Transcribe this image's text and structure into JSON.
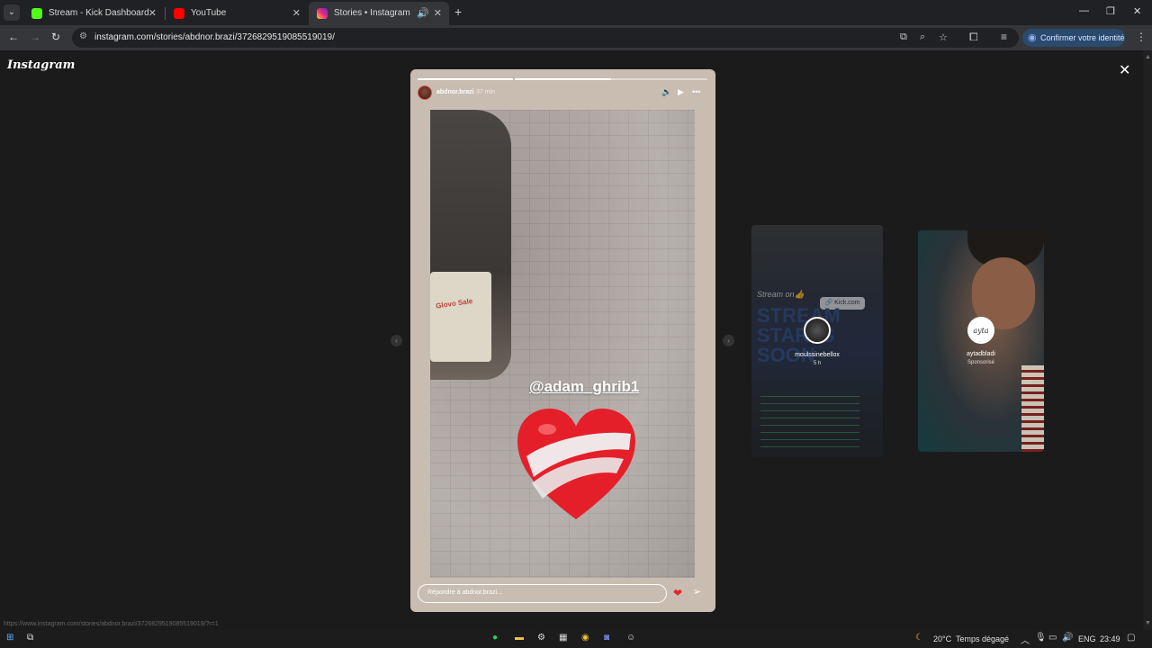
{
  "browser": {
    "tabs": [
      {
        "title": "Stream - Kick Dashboard",
        "icon": "kick-icon",
        "color": "#53fc18"
      },
      {
        "title": "YouTube",
        "icon": "youtube-icon",
        "color": "#ff0000"
      },
      {
        "title": "Stories • Instagram",
        "icon": "instagram-icon",
        "color": "#e1306c"
      }
    ],
    "url": "instagram.com/stories/abdnor.brazi/3726829519085519019/",
    "confirm_identity": "Confirmer votre identité"
  },
  "page": {
    "logo": "Instagram",
    "story": {
      "username": "abdnor.brazi",
      "time": "37 min",
      "mention": "@adam_ghrib1",
      "progress": [
        1.0,
        0.5
      ],
      "reply_placeholder": "Répondre à abdnor.brazi…",
      "scooter_label": "Glovo Sale"
    },
    "previews": [
      {
        "username": "moulssinebellox",
        "sub": "5 h",
        "stream_text": "Stream on👍",
        "kick_badge": "🔗 Kick.com",
        "big_text": "STREAM STARTS SOON"
      },
      {
        "username": "aytadbladi",
        "sub": "Sponsorisé",
        "avatar_text": "ayta"
      }
    ],
    "status_url": "https://www.instagram.com/stories/abdnor.brazi/3726829519085519019/?r=1"
  },
  "taskbar": {
    "weather": "20°C",
    "weather_text": "Temps dégagé",
    "lang": "ENG",
    "time": "23:49"
  }
}
